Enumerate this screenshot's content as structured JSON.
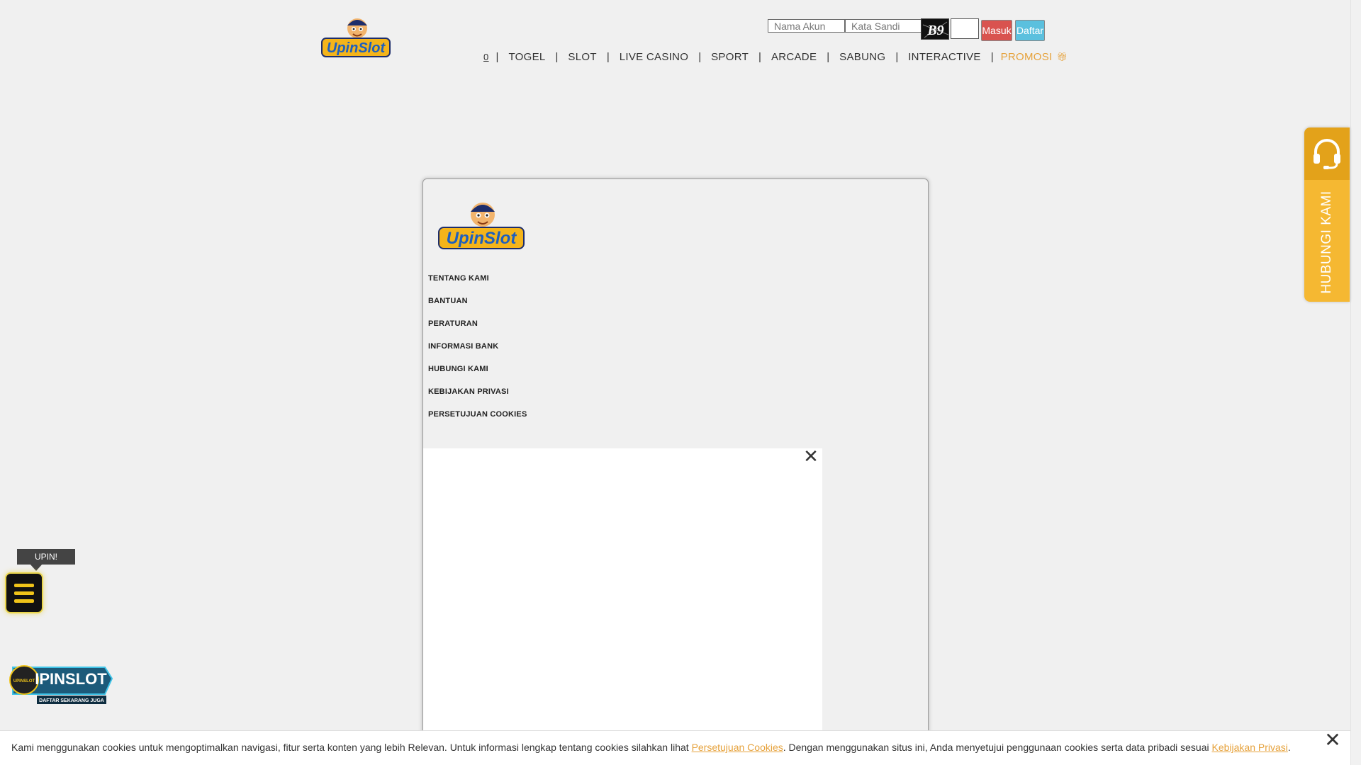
{
  "header": {
    "brand": "UpinSlot",
    "login": {
      "username_placeholder": "Nama Akun",
      "password_placeholder": "Kata Sandi",
      "captcha_text": "B9",
      "login_label": "Masuk",
      "register_label": "Daftar"
    },
    "nav": {
      "home_label": "0",
      "items": [
        "TOGEL",
        "SLOT",
        "LIVE CASINO",
        "SPORT",
        "ARCADE",
        "SABUNG",
        "INTERACTIVE"
      ],
      "promo_label": "PROMOSI",
      "separator": "|"
    }
  },
  "panel": {
    "brand": "UpinSlot",
    "links": [
      "TENTANG KAMI",
      "BANTUAN",
      "PERATURAN",
      "INFORMASI BANK",
      "HUBUNGI KAMI",
      "KEBIJAKAN PRIVASI",
      "PERSETUJUAN COOKIES"
    ]
  },
  "contact": {
    "label": "HUBUNGI KAMI"
  },
  "float_menu": {
    "tooltip": "UPIN!"
  },
  "banner": {
    "title": "IPINSLOT",
    "subtitle": "DAFTAR SEKARANG JUGA",
    "badge": "UPINSLOT"
  },
  "cookie": {
    "text_1": "Kami menggunakan cookies untuk mengoptimalkan navigasi, fitur serta konten yang lebih Relevan. Untuk informasi lengkap tentang cookies silahkan lihat ",
    "link_1": "Persetujuan Cookies",
    "text_2": ". Dengan menggunakan situs ini, Anda menyetujui penggunaan cookies serta data pribadi sesuai ",
    "link_2": "Kebijakan Privasi",
    "text_3": "."
  },
  "colors": {
    "accent": "#e6a23c",
    "login_btn": "#d9534f",
    "register_btn": "#5bc0de",
    "contact": "#f5b832"
  }
}
